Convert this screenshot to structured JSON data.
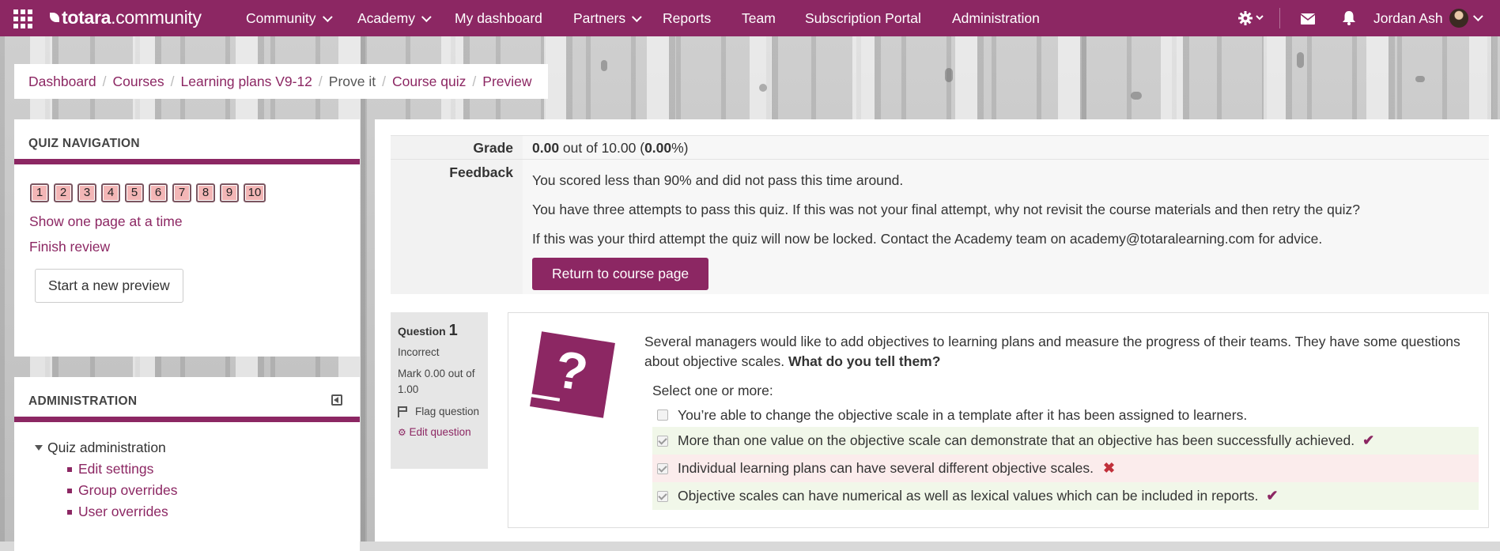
{
  "navbar": {
    "logo_bold": "totara",
    "logo_rest": "community",
    "items": [
      "Community",
      "Academy",
      "My dashboard",
      "Partners",
      "Reports",
      "Team",
      "Subscription Portal",
      "Administration"
    ],
    "user_name": "Jordan Ash",
    "icons": [
      "grid-menu-icon",
      "gear-icon",
      "envelope-icon",
      "bell-icon"
    ]
  },
  "breadcrumb": [
    "Dashboard",
    "Courses",
    "Learning plans V9-12",
    "Prove it",
    "Course quiz",
    "Preview"
  ],
  "quiz_navigation": {
    "title": "QUIZ NAVIGATION",
    "buttons": [
      "1",
      "2",
      "3",
      "4",
      "5",
      "6",
      "7",
      "8",
      "9",
      "10"
    ],
    "show_one_page": "Show one page at a time",
    "finish_review": "Finish review",
    "start_preview": "Start a new preview"
  },
  "administration": {
    "title": "ADMINISTRATION",
    "root": "Quiz administration",
    "items": [
      "Edit settings",
      "Group overrides",
      "User overrides"
    ]
  },
  "summary": {
    "grade_label": "Grade",
    "grade_score": "0.00",
    "grade_mid": " out of 10.00 (",
    "grade_pct": "0.00",
    "grade_end": "%)",
    "feedback_label": "Feedback",
    "feedback": [
      "You scored less than 90% and did not pass this time around.",
      "You have three attempts to pass this quiz. If this was not your final attempt, why not revisit the course materials and then retry the quiz?",
      "If this was your third attempt the quiz will now be locked. Contact the Academy team on academy@totaralearning.com for advice."
    ],
    "return_button": "Return to course page"
  },
  "question": {
    "label": "Question",
    "number": "1",
    "state": "Incorrect",
    "mark": "Mark 0.00 out of 1.00",
    "flag": "Flag question",
    "edit": "Edit question",
    "text": "Several managers would like to add objectives to learning plans and measure the progress of their teams. They have some questions about objective scales.",
    "text_bold": "What do you tell them?",
    "prompt": "Select one or more:",
    "answers": [
      {
        "text": "You’re able to change the objective scale in a template after it has been assigned to learners.",
        "checked": false,
        "result": "none"
      },
      {
        "text": "More than one value on the objective scale can demonstrate that an objective has been successfully achieved.",
        "checked": true,
        "result": "correct"
      },
      {
        "text": "Individual learning plans can have several different objective scales.",
        "checked": true,
        "result": "incorrect"
      },
      {
        "text": "Objective scales can have numerical as well as lexical values which can be included in reports.",
        "checked": true,
        "result": "correct"
      }
    ]
  },
  "colors": {
    "brand": "#8c2763",
    "correct_bg": "#f1f7e9",
    "incorrect_bg": "#fbecec",
    "incorrect_mark": "#c0303a"
  }
}
